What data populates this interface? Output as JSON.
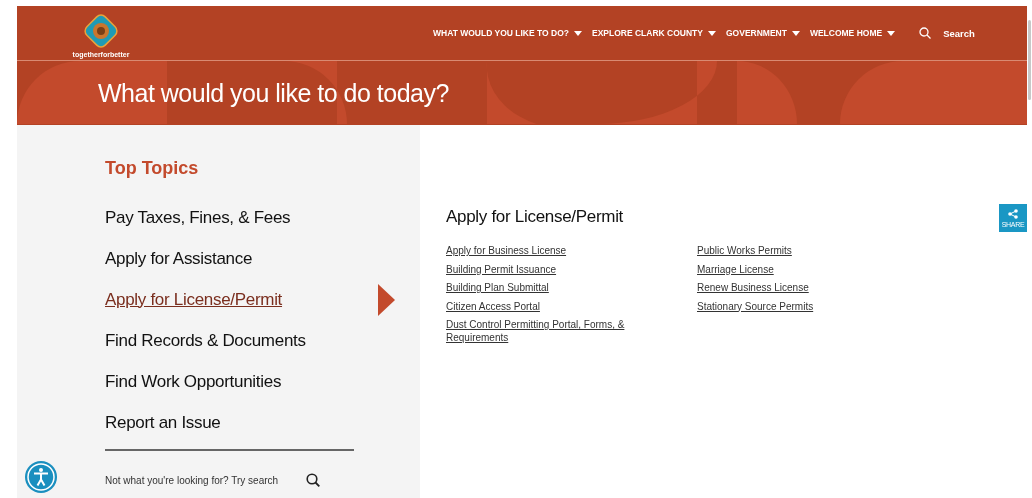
{
  "header": {
    "tagline": "togetherforbetter",
    "nav": [
      {
        "label": "WHAT WOULD YOU LIKE TO DO?"
      },
      {
        "label": "EXPLORE CLARK COUNTY"
      },
      {
        "label": "GOVERNMENT"
      },
      {
        "label": "WELCOME HOME"
      }
    ],
    "search_label": "Search"
  },
  "banner": {
    "title": "What would you like to do today?"
  },
  "topics": {
    "heading": "Top Topics",
    "items": [
      {
        "label": "Pay Taxes, Fines, & Fees",
        "selected": false
      },
      {
        "label": "Apply for Assistance",
        "selected": false
      },
      {
        "label": "Apply for License/Permit",
        "selected": true
      },
      {
        "label": "Find Records & Documents",
        "selected": false
      },
      {
        "label": "Find Work Opportunities",
        "selected": false
      },
      {
        "label": "Report an Issue",
        "selected": false
      }
    ],
    "search_prompt": "Not what you're looking for? Try search"
  },
  "detail": {
    "title": "Apply for License/Permit",
    "columns": [
      [
        "Apply for Business License",
        "Building Permit Issuance",
        "Building Plan Submittal",
        "Citizen Access Portal",
        "Dust Control Permitting Portal, Forms, & Requirements"
      ],
      [
        "Public Works Permits",
        "Marriage License",
        "Renew Business License",
        "Stationary Source Permits"
      ]
    ]
  },
  "share": {
    "label": "SHARE"
  }
}
